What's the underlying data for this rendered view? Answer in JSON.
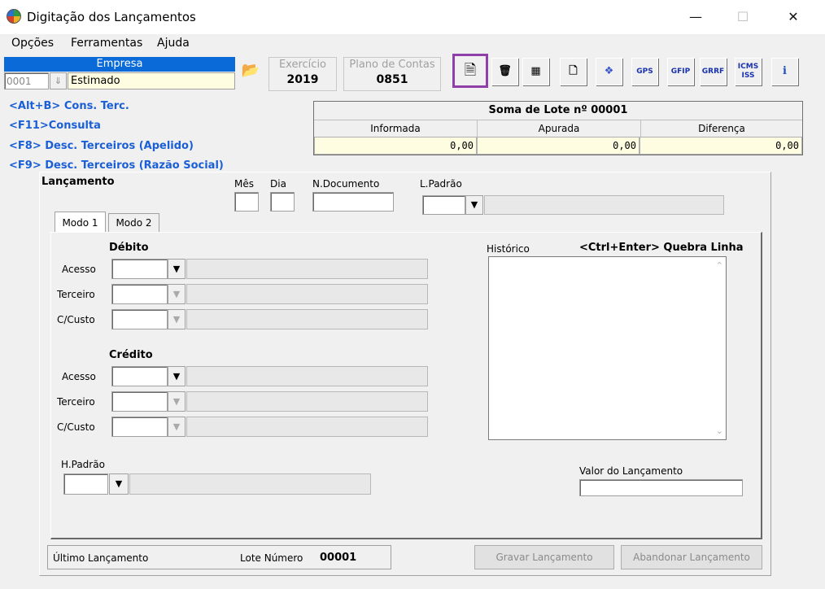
{
  "window": {
    "title": "Digitação dos Lançamentos",
    "minimize": "—",
    "maximize": "☐",
    "close": "✕"
  },
  "menu": [
    "Opções",
    "Ferramentas",
    "Ajuda"
  ],
  "empresa": {
    "label": "Empresa",
    "code": "0001",
    "name": "Estimado"
  },
  "exercicio": {
    "label": "Exercício",
    "value": "2019"
  },
  "plano": {
    "label": "Plano de Contas",
    "value": "0851"
  },
  "toolbar": {
    "gps": "GPS",
    "gfip": "GFIP",
    "grrf": "GRRF",
    "icms": "ICMS ISS",
    "info": "i"
  },
  "shortcuts": [
    "<Alt+B> Cons. Terc.",
    "<F11>Consulta",
    "<F8> Desc. Terceiros (Apelido)",
    "<F9> Desc. Terceiros (Razão Social)"
  ],
  "soma": {
    "title": "Soma de Lote nº 00001",
    "headers": [
      "Informada",
      "Apurada",
      "Diferença"
    ],
    "values": [
      "0,00",
      "0,00",
      "0,00"
    ]
  },
  "lancamento": {
    "title": "Lançamento",
    "mes": "Mês",
    "dia": "Dia",
    "documento": "N.Documento",
    "lpadrao": "L.Padrão"
  },
  "tabs": [
    "Modo 1",
    "Modo 2"
  ],
  "debito": {
    "title": "Débito",
    "acesso": "Acesso",
    "terceiro": "Terceiro",
    "custo": "C/Custo"
  },
  "credito": {
    "title": "Crédito",
    "acesso": "Acesso",
    "terceiro": "Terceiro",
    "custo": "C/Custo"
  },
  "historico": {
    "label": "Histórico",
    "hint": "<Ctrl+Enter> Quebra Linha"
  },
  "hpadrao": "H.Padrão",
  "valor": "Valor do Lançamento",
  "footer": {
    "ultimo": "Último Lançamento",
    "lote_label": "Lote Número",
    "lote_value": "00001",
    "gravar": "Gravar Lançamento",
    "abandonar": "Abandonar Lançamento"
  }
}
